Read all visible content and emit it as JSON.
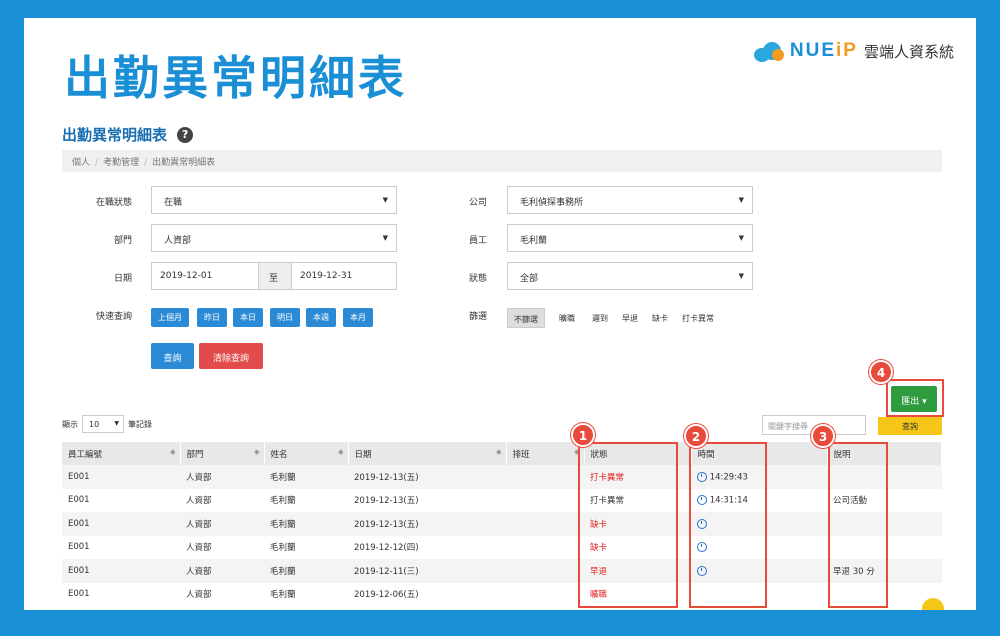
{
  "banner": {
    "big_title": "出勤異常明細表",
    "logo_brand_a": "NUE",
    "logo_brand_b": "iP",
    "logo_sub": "雲端人資系統"
  },
  "page": {
    "title": "出勤異常明細表",
    "breadcrumb": [
      "個人",
      "考勤管理",
      "出勤異常明細表"
    ]
  },
  "filters": {
    "employment_status_label": "在職狀態",
    "employment_status_value": "在職",
    "department_label": "部門",
    "department_value": "人資部",
    "date_label": "日期",
    "date_from": "2019-12-01",
    "date_to_sep": "至",
    "date_to": "2019-12-31",
    "quick_label": "快速查詢",
    "quick_buttons": [
      "上個月",
      "昨日",
      "本日",
      "明日",
      "本週",
      "本月"
    ],
    "company_label": "公司",
    "company_value": "毛利偵探事務所",
    "employee_label": "員工",
    "employee_value": "毛利蘭",
    "status_label": "狀態",
    "status_value": "全部",
    "screen_label": "篩選",
    "screen_options": [
      "不篩選",
      "曠職",
      "遲到",
      "早退",
      "缺卡",
      "打卡異常"
    ],
    "query_button": "查詢",
    "clear_button": "清除查詢"
  },
  "toolbar": {
    "export_button": "匯出",
    "show_prefix": "顯示",
    "show_count": "10",
    "show_suffix": "筆記錄",
    "keyword_placeholder": "關鍵字搜尋",
    "keyword_button": "查詢"
  },
  "badges": [
    "1",
    "2",
    "3",
    "4"
  ],
  "table": {
    "headers": [
      "員工編號",
      "部門",
      "姓名",
      "日期",
      "排班",
      "狀態",
      "時間",
      "說明"
    ],
    "rows": [
      {
        "id": "E001",
        "dept": "人資部",
        "name": "毛利蘭",
        "date": "2019-12-13(五)",
        "shift": "",
        "status": "打卡異常",
        "time": "14:29:43",
        "note": ""
      },
      {
        "id": "E001",
        "dept": "人資部",
        "name": "毛利蘭",
        "date": "2019-12-13(五)",
        "shift": "",
        "status": "打卡異常",
        "time": "14:31:14",
        "note": "公司活動"
      },
      {
        "id": "E001",
        "dept": "人資部",
        "name": "毛利蘭",
        "date": "2019-12-13(五)",
        "shift": "",
        "status": "缺卡",
        "time": "",
        "note": ""
      },
      {
        "id": "E001",
        "dept": "人資部",
        "name": "毛利蘭",
        "date": "2019-12-12(四)",
        "shift": "",
        "status": "缺卡",
        "time": "",
        "note": ""
      },
      {
        "id": "E001",
        "dept": "人資部",
        "name": "毛利蘭",
        "date": "2019-12-11(三)",
        "shift": "",
        "status": "早退",
        "time": "",
        "note": "早退 30 分"
      },
      {
        "id": "E001",
        "dept": "人資部",
        "name": "毛利蘭",
        "date": "2019-12-06(五)",
        "shift": "",
        "status": "曠職",
        "time": "",
        "note": ""
      }
    ]
  },
  "colors": {
    "frame": "#1990d6",
    "primary": "#2b8ad6",
    "danger": "#e14b4b",
    "success": "#2e9b3f",
    "warning": "#f5c518",
    "annotation": "#e84a3c"
  }
}
